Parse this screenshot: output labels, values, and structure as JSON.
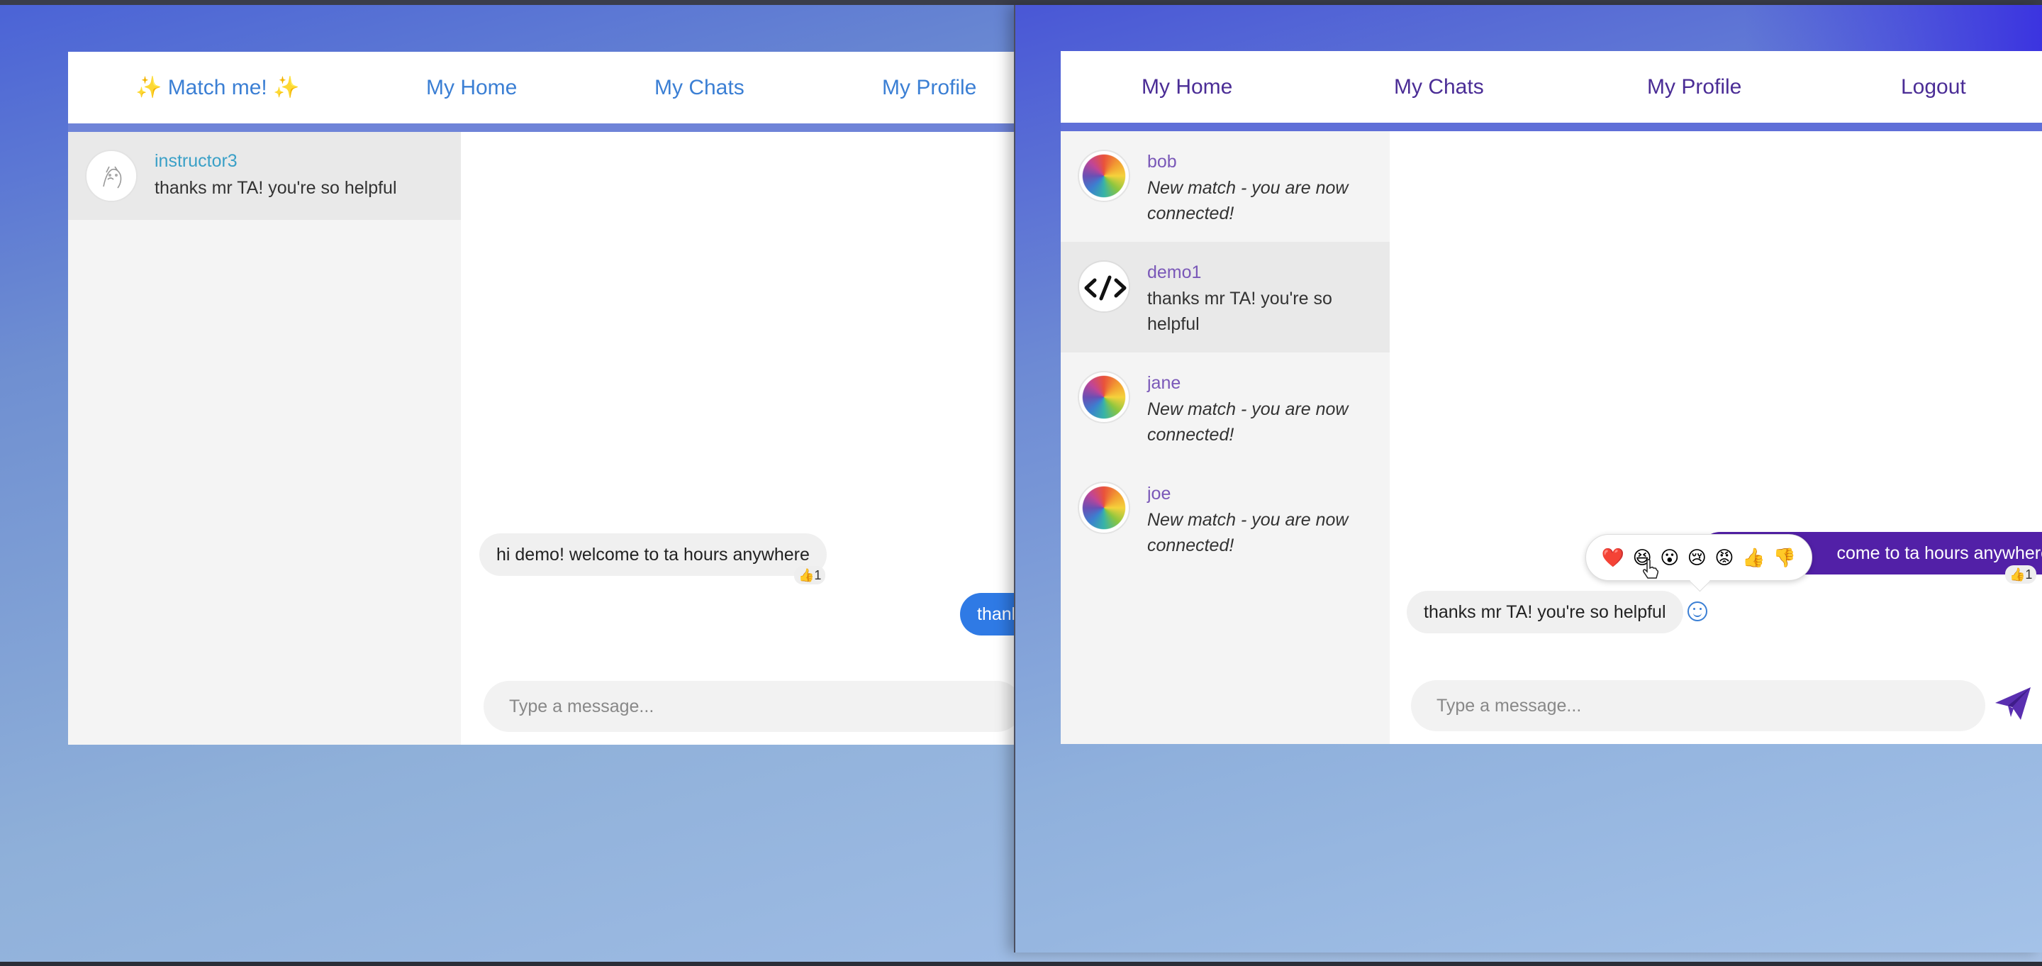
{
  "left_window": {
    "nav": {
      "match": "✨ Match me! ✨",
      "home": "My Home",
      "chats": "My Chats",
      "profile": "My Profile"
    },
    "conversations": [
      {
        "name": "instructor3",
        "preview": "thanks mr TA! you're so helpful"
      }
    ],
    "messages": {
      "incoming": "hi demo! welcome to ta hours anywhere",
      "incoming_reaction": "👍1",
      "outgoing_partial": "thank"
    },
    "input_placeholder": "Type a message..."
  },
  "right_window": {
    "nav": {
      "home": "My Home",
      "chats": "My Chats",
      "profile": "My Profile",
      "logout": "Logout"
    },
    "conversations": [
      {
        "name": "bob",
        "preview": "New match - you are now connected!"
      },
      {
        "name": "demo1",
        "preview": "thanks mr TA! you're so helpful"
      },
      {
        "name": "jane",
        "preview": "New match - you are now connected!"
      },
      {
        "name": "joe",
        "preview": "New match - you are now connected!"
      }
    ],
    "messages": {
      "outgoing_partial": "come to ta hours anywhere",
      "outgoing_reaction": "👍1",
      "incoming": "thanks mr TA! you're so helpful"
    },
    "emoji_picker": [
      "❤️",
      "😆",
      "😮",
      "😢",
      "😡",
      "👍",
      "👎"
    ],
    "input_placeholder": "Type a message...",
    "icons": {
      "send": "send-icon",
      "smiley": "smiley-icon",
      "code_avatar": "code-icon"
    }
  },
  "colors": {
    "left_accent": "#3b7fd4",
    "right_accent": "#4b2d96",
    "outgoing_blue": "#2f7ae5",
    "outgoing_purple": "#5220a7"
  }
}
